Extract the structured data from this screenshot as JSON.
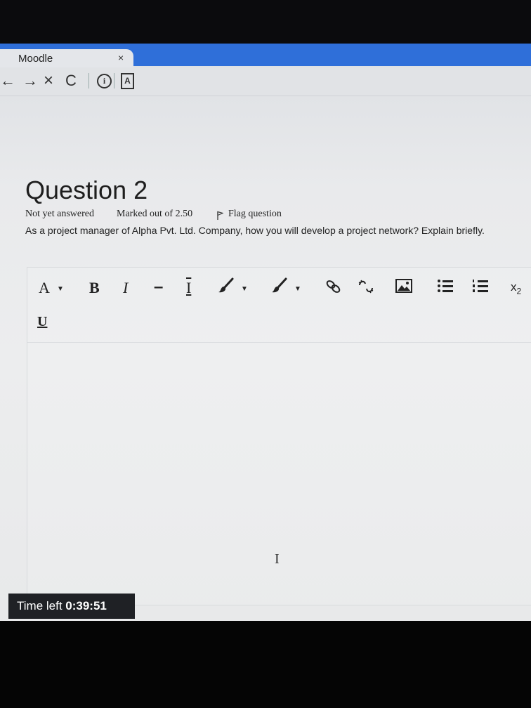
{
  "browser": {
    "tab_title": "Moodle",
    "tab_close": "×",
    "nav": {
      "back": "←",
      "forward": "→",
      "stop": "×",
      "reload": "C",
      "info": "i",
      "page": "A"
    }
  },
  "question": {
    "title": "Question 2",
    "status": "Not yet answered",
    "marks": "Marked out of 2.50",
    "flag_label": "Flag question",
    "text": "As a project manager of Alpha Pvt. Ltd. Company, how you will develop a project network? Explain briefly."
  },
  "editor": {
    "toolbar": {
      "font": "A",
      "bold": "B",
      "italic": "I",
      "strike": "–",
      "clear_format": "I",
      "link": "⚭",
      "subscript_base": "x",
      "subscript_sub": "2",
      "underline": "U"
    }
  },
  "timer": {
    "label": "Time left",
    "value": "0:39:51"
  }
}
